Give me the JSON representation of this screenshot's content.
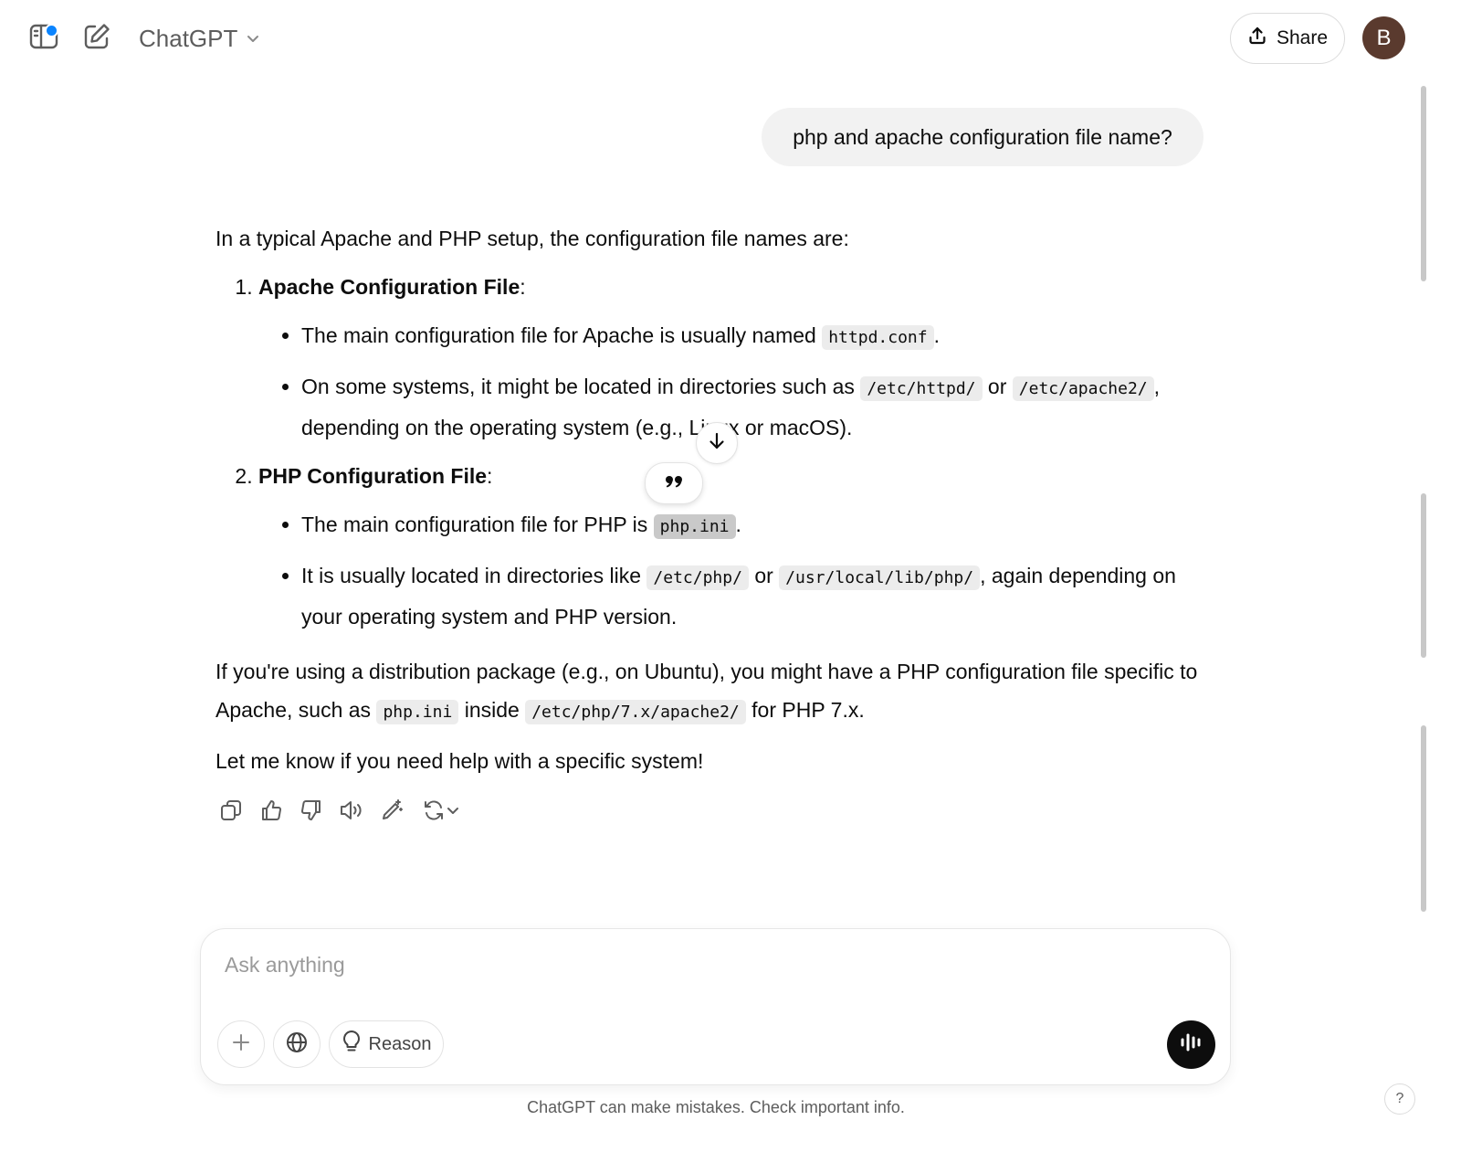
{
  "header": {
    "model_name": "ChatGPT",
    "share_label": "Share",
    "avatar_initial": "B"
  },
  "conversation": {
    "user_message": "php and apache configuration file name?",
    "answer": {
      "intro": "In a typical Apache and PHP setup, the configuration file names are:",
      "sections": [
        {
          "heading": "Apache Configuration File",
          "bullet1_text": "The main configuration file for Apache is usually named ",
          "bullet1_code": "httpd.conf",
          "bullet2_text_a": "On some systems, it might be located in directories such as ",
          "bullet2_code_a": "/etc/httpd/",
          "bullet2_text_b": " or ",
          "bullet2_code_b": "/etc/apache2/",
          "bullet2_text_c": ", depending on the operating system (e.g., Linux or macOS)."
        },
        {
          "heading": "PHP Configuration File",
          "bullet1_text": "The main configuration file for PHP is ",
          "bullet1_code": "php.ini",
          "bullet2_text_a": "It is usually located in directories like ",
          "bullet2_code_a": "/etc/php/",
          "bullet2_text_b": " or ",
          "bullet2_code_b": "/usr/local/lib/php/",
          "bullet2_text_c": ", again depending on your operating system and PHP version."
        }
      ],
      "para2_text_a": "If you're using a distribution package (e.g., on Ubuntu), you might have a PHP configuration file specific to Apache, such as ",
      "para2_code_a": "php.ini",
      "para2_text_b": " inside ",
      "para2_code_b": "/etc/php/7.x/apache2/",
      "para2_text_c": " for PHP 7.x.",
      "closing": "Let me know if you need help with a specific system!"
    }
  },
  "composer": {
    "placeholder": "Ask anything",
    "reason_label": "Reason"
  },
  "footer": {
    "disclaimer": "ChatGPT can make mistakes. Check important info.",
    "help_label": "?"
  }
}
